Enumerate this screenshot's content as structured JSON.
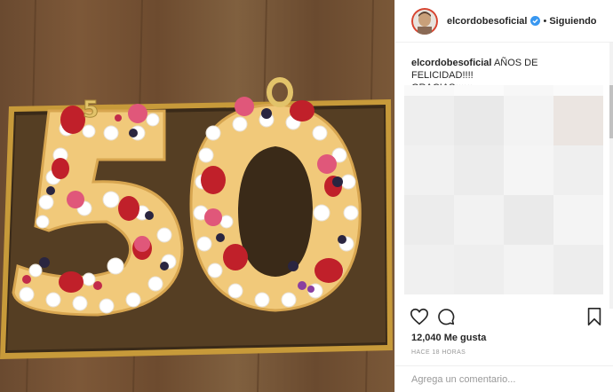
{
  "header": {
    "username": "elcordobesoficial",
    "separator": "•",
    "follow_status": "Siguiendo"
  },
  "caption": {
    "username": "elcordobesoficial",
    "text": "AÑOS DE FELICIDAD!!!!",
    "text_line2": "GRACIAS♥♥♥"
  },
  "photo": {
    "subject": "number-50 cake with strawberries, macarons and meringues"
  },
  "actions": {
    "like_icon": "heart-icon",
    "comment_icon": "comment-icon",
    "save_icon": "bookmark-icon"
  },
  "likes": {
    "count_label": "12,040 Me gusta"
  },
  "timestamp": "HACE 18 HORAS",
  "comment_input": {
    "placeholder": "Agrega un comentario..."
  },
  "colors": {
    "verified": "#3897f0",
    "text": "#262626",
    "muted": "#999999"
  }
}
